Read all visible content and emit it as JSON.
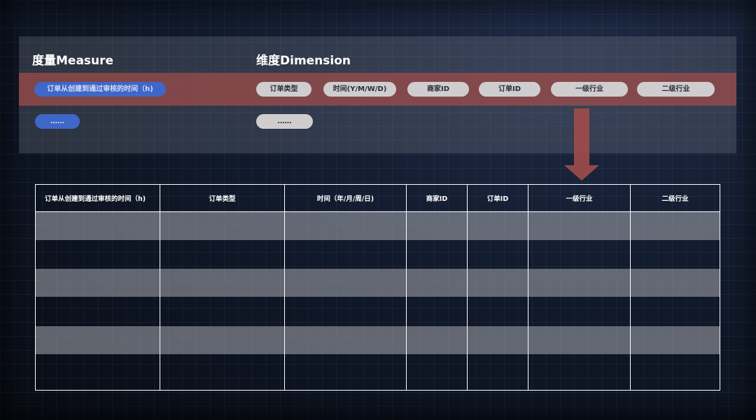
{
  "measure": {
    "heading": "度量Measure",
    "items": [
      "订单从创建到通过审核的时间（h)",
      "……"
    ]
  },
  "dimension": {
    "heading": "维度Dimension",
    "items": [
      "订单类型",
      "时间(Y/M/W/D)",
      "商家ID",
      "订单ID",
      "一级行业",
      "二级行业",
      "……"
    ]
  },
  "table": {
    "columns": [
      "订单从创建到通过审核的时间（h)",
      "订单类型",
      "时间（年/月/周/日)",
      "商家ID",
      "订单ID",
      "一级行业",
      "二级行业"
    ],
    "row_count": 6,
    "rows": [
      [
        "",
        "",
        "",
        "",
        "",
        "",
        ""
      ],
      [
        "",
        "",
        "",
        "",
        "",
        "",
        ""
      ],
      [
        "",
        "",
        "",
        "",
        "",
        "",
        ""
      ],
      [
        "",
        "",
        "",
        "",
        "",
        "",
        ""
      ],
      [
        "",
        "",
        "",
        "",
        "",
        "",
        ""
      ],
      [
        "",
        "",
        "",
        "",
        "",
        "",
        ""
      ]
    ]
  },
  "colors": {
    "highlight_band": "#9e4c4a",
    "measure_pill": "#3f67c9",
    "dimension_pill": "#d0cdce",
    "arrow": "#9e4c4a",
    "row_stripe": "#8f929a"
  },
  "icons": {
    "arrow": "arrow-down-icon"
  }
}
